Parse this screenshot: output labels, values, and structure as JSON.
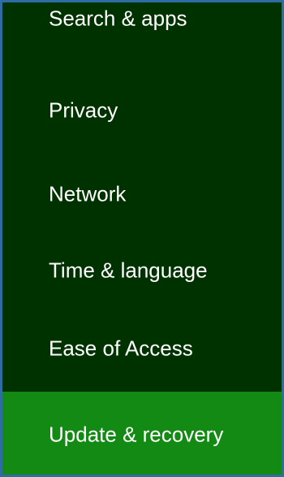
{
  "settings_menu": {
    "items": [
      {
        "label": "Search & apps",
        "selected": false
      },
      {
        "label": "Privacy",
        "selected": false
      },
      {
        "label": "Network",
        "selected": false
      },
      {
        "label": "Time & language",
        "selected": false
      },
      {
        "label": "Ease of Access",
        "selected": false
      },
      {
        "label": "Update & recovery",
        "selected": true
      }
    ]
  },
  "colors": {
    "background": "#003200",
    "selected_background": "#138a13",
    "text": "#ffffff",
    "frame_border": "#2e6da4"
  }
}
